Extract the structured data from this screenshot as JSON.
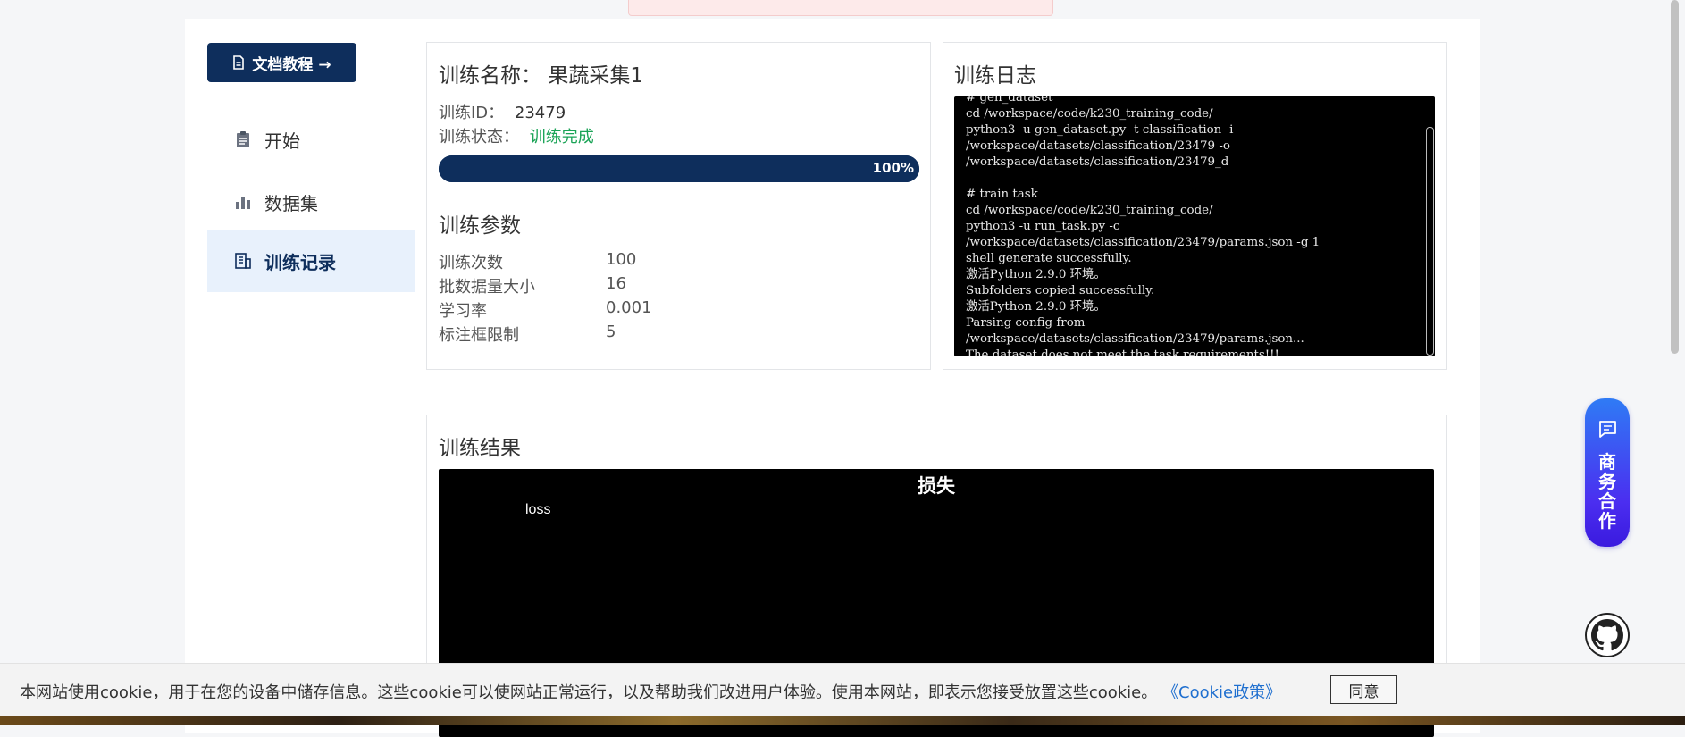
{
  "doc_button": {
    "label": "文档教程 →"
  },
  "sidebar": {
    "items": [
      {
        "label": "开始",
        "icon": "clipboard-icon",
        "active": false
      },
      {
        "label": "数据集",
        "icon": "bar-chart-icon",
        "active": false
      },
      {
        "label": "训练记录",
        "icon": "records-icon",
        "active": true
      }
    ]
  },
  "training": {
    "name_label": "训练名称：",
    "name_value": "果蔬采集1",
    "id_label": "训练ID：",
    "id_value": "23479",
    "status_label": "训练状态：",
    "status_value": "训练完成",
    "status_color": "#1aa356",
    "progress_percent": 100,
    "progress_text": "100%",
    "params_title": "训练参数",
    "params": [
      {
        "label": "训练次数",
        "value": "100"
      },
      {
        "label": "批数据量大小",
        "value": "16"
      },
      {
        "label": "学习率",
        "value": "0.001"
      },
      {
        "label": "标注框限制",
        "value": "5"
      }
    ]
  },
  "log": {
    "title": "训练日志",
    "lines": [
      "# gen_dataset",
      "cd /workspace/code/k230_training_code/",
      "python3 -u gen_dataset.py -t classification -i",
      "/workspace/datasets/classification/23479 -o",
      "/workspace/datasets/classification/23479_d",
      "",
      "# train task",
      "cd /workspace/code/k230_training_code/",
      "python3 -u run_task.py -c",
      "/workspace/datasets/classification/23479/params.json -g 1",
      "shell generate successfully.",
      "激活Python 2.9.0 环境。",
      "Subfolders copied successfully.",
      "激活Python 2.9.0 环境。",
      "Parsing config from",
      "/workspace/datasets/classification/23479/params.json...",
      "The dataset does not meet the task requirements!!!"
    ]
  },
  "results": {
    "title": "训练结果",
    "chart_title": "损失",
    "legend": "loss"
  },
  "chart_data": {
    "type": "line",
    "title": "损失",
    "series": [
      {
        "name": "loss",
        "values": []
      }
    ]
  },
  "float_button": {
    "label": "商务合作",
    "icon": "chat-icon"
  },
  "github": {
    "icon": "github-icon"
  },
  "cookie": {
    "text": "本网站使用cookie，用于在您的设备中储存信息。这些cookie可以使网站正常运行，以及帮助我们改进用户体验。使用本网站，即表示您接受放置这些cookie。",
    "link": "《Cookie政策》",
    "agree": "同意"
  },
  "colors": {
    "brand": "#0e2e5c",
    "active_bg": "#e8f1fc",
    "link": "#1f6fcf"
  }
}
